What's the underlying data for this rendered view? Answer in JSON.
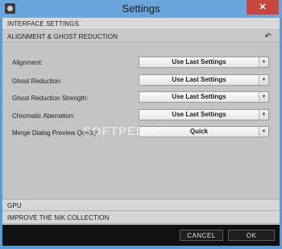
{
  "window": {
    "title": "Settings",
    "close_label": "✕"
  },
  "sections": {
    "interface": "INTERFACE SETTINGS",
    "alignment": "ALIGNMENT & GHOST REDUCTION",
    "gpu": "GPU",
    "improve": "IMPROVE THE NIK COLLECTION"
  },
  "icons": {
    "back": "↶",
    "dropdown": "▼"
  },
  "settings": [
    {
      "label": "Alignment:",
      "value": "Use Last Settings"
    },
    {
      "label": "Ghost Reduction:",
      "value": "Use Last Settings"
    },
    {
      "label": "Ghost Reduction Strength:",
      "value": "Use Last Settings"
    },
    {
      "label": "Chromatic Aberration:",
      "value": "Use Last Settings"
    },
    {
      "label": "Merge Dialog Preview Quality:",
      "value": "Quick"
    }
  ],
  "footer": {
    "cancel": "CANCEL",
    "ok": "OK"
  },
  "watermark": "SOFTPEDIA"
}
